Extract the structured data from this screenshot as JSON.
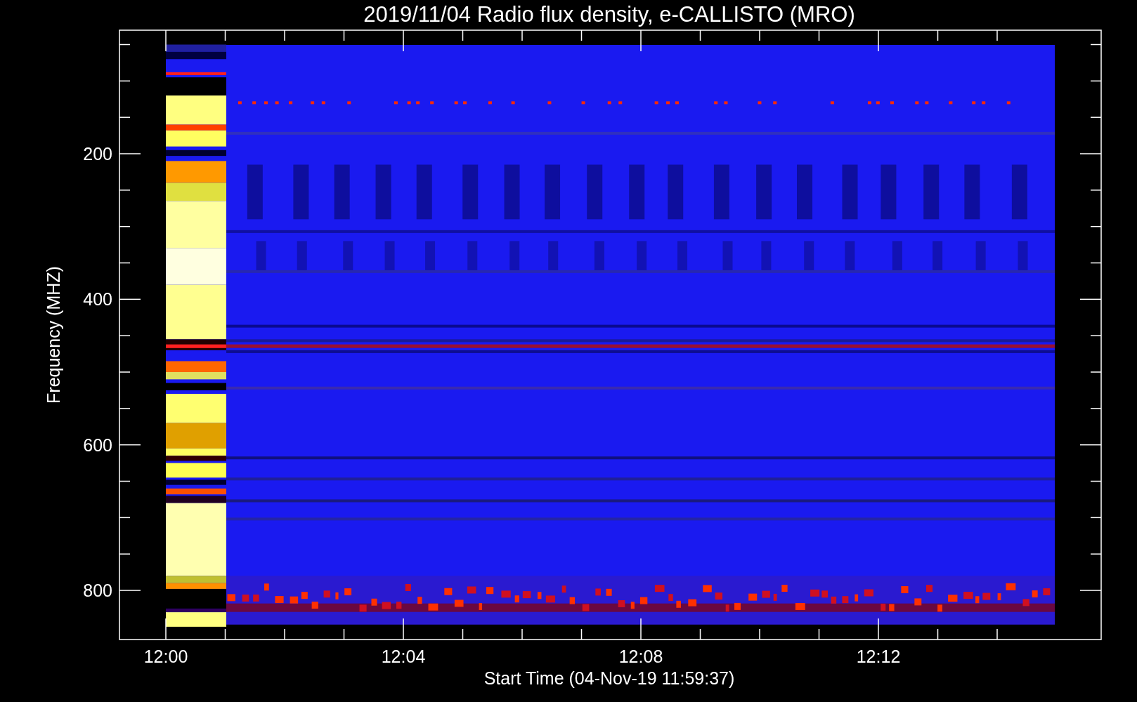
{
  "title": "2019/11/04  Radio flux density, e-CALLISTO (MRO)",
  "y_axis": {
    "label": "Frequency (MHZ)",
    "tick_labels": [
      "200",
      "400",
      "600",
      "800"
    ]
  },
  "x_axis": {
    "label": "Start Time (04-Nov-19 11:59:37)",
    "tick_labels": [
      "12:00",
      "12:04",
      "12:08",
      "12:12"
    ]
  }
}
